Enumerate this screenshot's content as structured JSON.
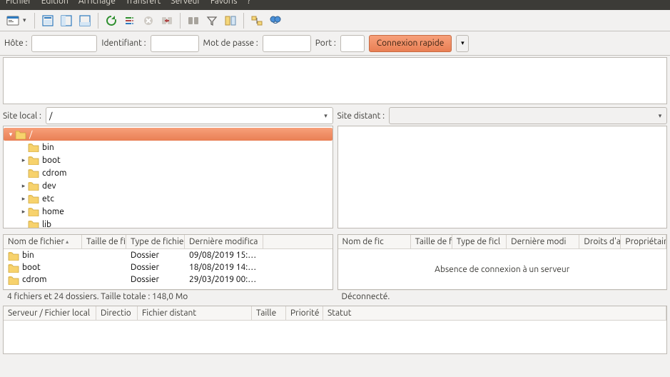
{
  "menu": {
    "items": [
      "Fichier",
      "Édition",
      "Affichage",
      "Transfert",
      "Serveur",
      "Favoris",
      "?"
    ]
  },
  "quickconnect": {
    "host_label": "Hôte :",
    "user_label": "Identifiant :",
    "pass_label": "Mot de passe :",
    "port_label": "Port :",
    "button": "Connexion rapide",
    "host": "",
    "user": "",
    "pass": "",
    "port": ""
  },
  "local": {
    "label": "Site local :",
    "path": "/",
    "tree": [
      {
        "depth": 0,
        "expander": "▾",
        "name": "/",
        "selected": true
      },
      {
        "depth": 1,
        "expander": "",
        "name": "bin"
      },
      {
        "depth": 1,
        "expander": "▸",
        "name": "boot"
      },
      {
        "depth": 1,
        "expander": "",
        "name": "cdrom"
      },
      {
        "depth": 1,
        "expander": "▸",
        "name": "dev"
      },
      {
        "depth": 1,
        "expander": "▸",
        "name": "etc"
      },
      {
        "depth": 1,
        "expander": "▸",
        "name": "home"
      },
      {
        "depth": 1,
        "expander": "",
        "name": "lib"
      }
    ],
    "columns": {
      "name": "Nom de fichier",
      "size": "Taille de fic",
      "type": "Type de fichier",
      "mod": "Dernière modifica"
    },
    "rows": [
      {
        "name": "bin",
        "type": "Dossier",
        "mod": "09/08/2019 15:…"
      },
      {
        "name": "boot",
        "type": "Dossier",
        "mod": "18/08/2019 14:…"
      },
      {
        "name": "cdrom",
        "type": "Dossier",
        "mod": "29/03/2019 00:…"
      }
    ],
    "status": "4 fichiers et 24 dossiers. Taille totale : 148,0 Mo"
  },
  "remote": {
    "label": "Site distant :",
    "path": "",
    "columns": {
      "name": "Nom de fic",
      "size": "Taille de fi",
      "type": "Type de ficl",
      "mod": "Dernière modi",
      "perm": "Droits d'ac",
      "own": "Propriétair"
    },
    "empty": "Absence de connexion à un serveur",
    "status": "Déconnecté."
  },
  "queue": {
    "columns": {
      "server": "Serveur / Fichier local",
      "dir": "Directio",
      "remote": "Fichier distant",
      "size": "Taille",
      "prio": "Priorité",
      "status": "Statut"
    }
  }
}
